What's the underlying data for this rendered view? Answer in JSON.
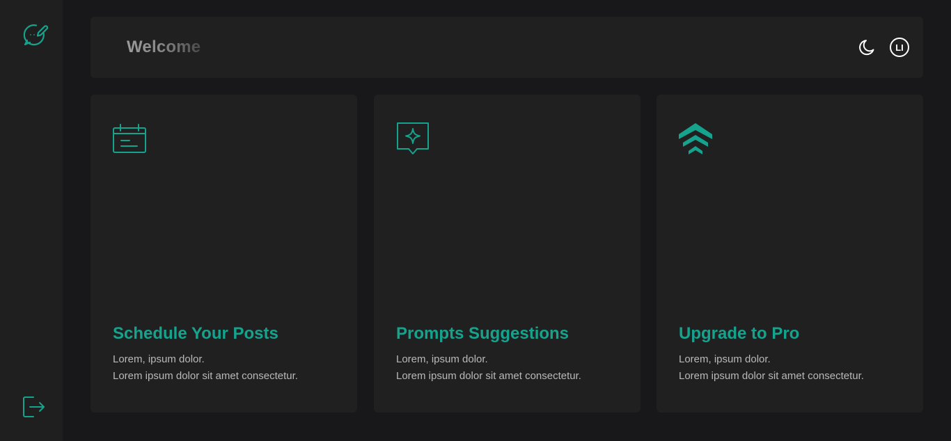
{
  "header": {
    "welcome_text": "Welcome",
    "avatar_initials": "LI"
  },
  "icons": {
    "logo": "chat-bubble-pen-icon",
    "logout": "logout-icon",
    "theme": "moon-icon"
  },
  "colors": {
    "accent": "#16a38e",
    "background": "#18181a",
    "panel": "#202020",
    "text_muted": "#b9b9b9"
  },
  "cards": [
    {
      "icon": "calendar-icon",
      "title": "Schedule Your Posts",
      "line1": "Lorem, ipsum dolor.",
      "line2": "Lorem ipsum dolor sit amet consectetur."
    },
    {
      "icon": "sparkle-message-icon",
      "title": "Prompts Suggestions",
      "line1": "Lorem, ipsum dolor.",
      "line2": "Lorem ipsum dolor sit amet consectetur."
    },
    {
      "icon": "chevrons-up-icon",
      "title": "Upgrade to Pro",
      "line1": "Lorem, ipsum dolor.",
      "line2": "Lorem ipsum dolor sit amet consectetur."
    }
  ]
}
